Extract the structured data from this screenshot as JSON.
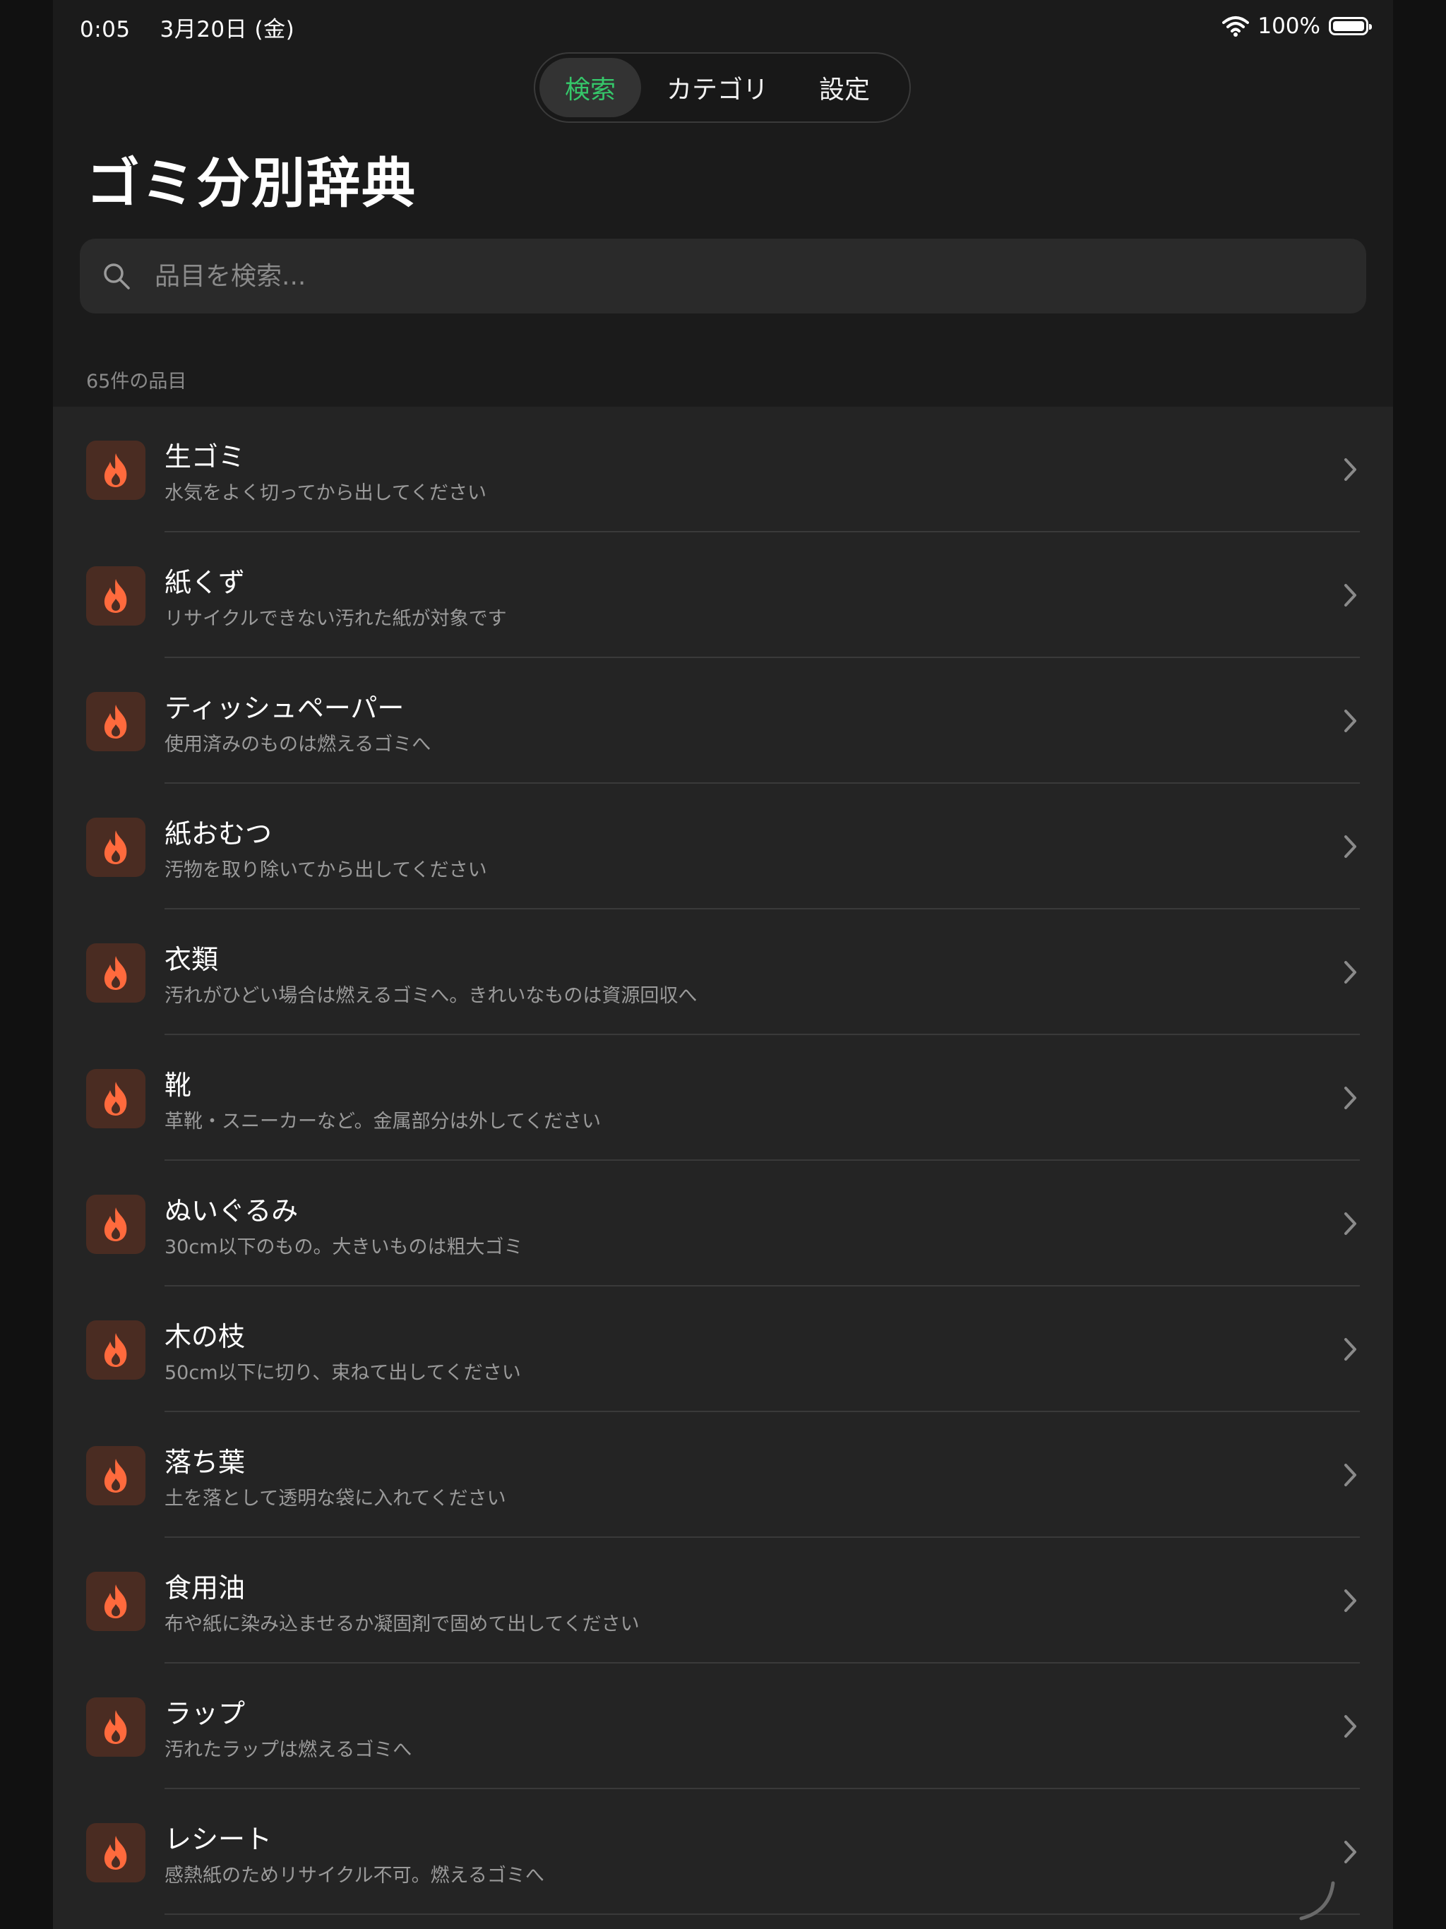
{
  "status": {
    "time": "0:05　 3月20日 (金)",
    "battery": "100%"
  },
  "tabs": [
    {
      "label": "検索",
      "active": true
    },
    {
      "label": "カテゴリ",
      "active": false
    },
    {
      "label": "設定",
      "active": false
    }
  ],
  "title": "ゴミ分別辞典",
  "search": {
    "placeholder": "品目を検索...",
    "icon": "search-icon"
  },
  "count_label": "65件の品目",
  "colors": {
    "accent_green": "#35c76a",
    "flame": "#ff6a3d",
    "icon_bg": "#4a2c22"
  },
  "items": [
    {
      "title": "生ゴミ",
      "subtitle": "水気をよく切ってから出してください",
      "icon": "flame-icon"
    },
    {
      "title": "紙くず",
      "subtitle": "リサイクルできない汚れた紙が対象です",
      "icon": "flame-icon"
    },
    {
      "title": "ティッシュペーパー",
      "subtitle": "使用済みのものは燃えるゴミへ",
      "icon": "flame-icon"
    },
    {
      "title": "紙おむつ",
      "subtitle": "汚物を取り除いてから出してください",
      "icon": "flame-icon"
    },
    {
      "title": "衣類",
      "subtitle": "汚れがひどい場合は燃えるゴミへ。きれいなものは資源回収へ",
      "icon": "flame-icon"
    },
    {
      "title": "靴",
      "subtitle": "革靴・スニーカーなど。金属部分は外してください",
      "icon": "flame-icon"
    },
    {
      "title": "ぬいぐるみ",
      "subtitle": "30cm以下のもの。大きいものは粗大ゴミ",
      "icon": "flame-icon"
    },
    {
      "title": "木の枝",
      "subtitle": "50cm以下に切り、束ねて出してください",
      "icon": "flame-icon"
    },
    {
      "title": "落ち葉",
      "subtitle": "土を落として透明な袋に入れてください",
      "icon": "flame-icon"
    },
    {
      "title": "食用油",
      "subtitle": "布や紙に染み込ませるか凝固剤で固めて出してください",
      "icon": "flame-icon"
    },
    {
      "title": "ラップ",
      "subtitle": "汚れたラップは燃えるゴミへ",
      "icon": "flame-icon"
    },
    {
      "title": "レシート",
      "subtitle": "感熱紙のためリサイクル不可。燃えるゴミへ",
      "icon": "flame-icon"
    }
  ]
}
